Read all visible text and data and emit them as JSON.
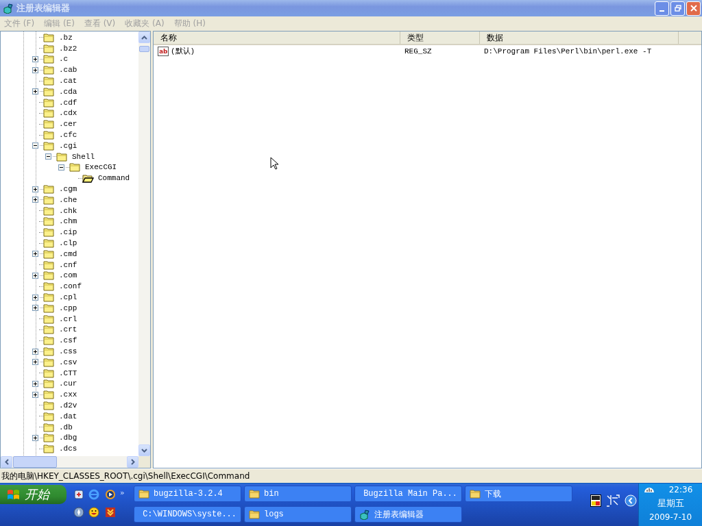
{
  "window": {
    "title": "注册表编辑器",
    "active": false
  },
  "menu": [
    "文件 (F)",
    "编辑 (E)",
    "查看 (V)",
    "收藏夹 (A)",
    "帮助 (H)"
  ],
  "tree": {
    "items": [
      {
        "label": ".bz",
        "kind": "leaf",
        "selected": false
      },
      {
        "label": ".bz2",
        "kind": "leaf",
        "selected": false
      },
      {
        "label": ".c",
        "kind": "collapsed",
        "selected": false
      },
      {
        "label": ".cab",
        "kind": "collapsed",
        "selected": false
      },
      {
        "label": ".cat",
        "kind": "leaf",
        "selected": false
      },
      {
        "label": ".cda",
        "kind": "collapsed",
        "selected": false
      },
      {
        "label": ".cdf",
        "kind": "leaf",
        "selected": false
      },
      {
        "label": ".cdx",
        "kind": "leaf",
        "selected": false
      },
      {
        "label": ".cer",
        "kind": "leaf",
        "selected": false
      },
      {
        "label": ".cfc",
        "kind": "leaf",
        "selected": false
      },
      {
        "label": ".cgi",
        "kind": "expanded",
        "selected": false,
        "children": [
          {
            "label": "Shell",
            "kind": "expanded",
            "selected": false,
            "children": [
              {
                "label": "ExecCGI",
                "kind": "expanded",
                "selected": false,
                "children": [
                  {
                    "label": "Command",
                    "kind": "leaf",
                    "selected": true
                  }
                ]
              }
            ]
          }
        ]
      },
      {
        "label": ".cgm",
        "kind": "collapsed",
        "selected": false
      },
      {
        "label": ".che",
        "kind": "collapsed",
        "selected": false
      },
      {
        "label": ".chk",
        "kind": "leaf",
        "selected": false
      },
      {
        "label": ".chm",
        "kind": "leaf",
        "selected": false
      },
      {
        "label": ".cip",
        "kind": "leaf",
        "selected": false
      },
      {
        "label": ".clp",
        "kind": "leaf",
        "selected": false
      },
      {
        "label": ".cmd",
        "kind": "collapsed",
        "selected": false
      },
      {
        "label": ".cnf",
        "kind": "leaf",
        "selected": false
      },
      {
        "label": ".com",
        "kind": "collapsed",
        "selected": false
      },
      {
        "label": ".conf",
        "kind": "leaf",
        "selected": false
      },
      {
        "label": ".cpl",
        "kind": "collapsed",
        "selected": false
      },
      {
        "label": ".cpp",
        "kind": "collapsed",
        "selected": false
      },
      {
        "label": ".crl",
        "kind": "leaf",
        "selected": false
      },
      {
        "label": ".crt",
        "kind": "leaf",
        "selected": false
      },
      {
        "label": ".csf",
        "kind": "leaf",
        "selected": false
      },
      {
        "label": ".css",
        "kind": "collapsed",
        "selected": false
      },
      {
        "label": ".csv",
        "kind": "collapsed",
        "selected": false
      },
      {
        "label": ".CTT",
        "kind": "leaf",
        "selected": false
      },
      {
        "label": ".cur",
        "kind": "collapsed",
        "selected": false
      },
      {
        "label": ".cxx",
        "kind": "collapsed",
        "selected": false
      },
      {
        "label": ".d2v",
        "kind": "leaf",
        "selected": false
      },
      {
        "label": ".dat",
        "kind": "leaf",
        "selected": false
      },
      {
        "label": ".db",
        "kind": "leaf",
        "selected": false
      },
      {
        "label": ".dbg",
        "kind": "collapsed",
        "selected": false
      },
      {
        "label": ".dcs",
        "kind": "leaf",
        "selected": false
      }
    ]
  },
  "list": {
    "columns": [
      "名称",
      "类型",
      "数据"
    ],
    "rows": [
      {
        "icon": "ab",
        "name": "(默认)",
        "type": "REG_SZ",
        "data": "D:\\Program Files\\Perl\\bin\\perl.exe -T"
      }
    ]
  },
  "status_bar": "我的电脑\\HKEY_CLASSES_ROOT\\.cgi\\Shell\\ExecCGI\\Command",
  "taskbar": {
    "start": "开始",
    "overflow": "»",
    "tasks": [
      {
        "label": "bugzilla-3.2.4",
        "kind": "folder"
      },
      {
        "label": "bin",
        "kind": "folder"
      },
      {
        "label": "Bugzilla Main Pa...",
        "kind": "browser"
      },
      {
        "label": "下载",
        "kind": "folder"
      },
      {
        "label": "C:\\WINDOWS\\syste...",
        "kind": "console"
      },
      {
        "label": "logs",
        "kind": "folder"
      },
      {
        "label": "注册表编辑器",
        "kind": "regedit"
      }
    ],
    "clock": {
      "time": "22:36",
      "day": "星期五",
      "date": "2009-7-10"
    }
  }
}
